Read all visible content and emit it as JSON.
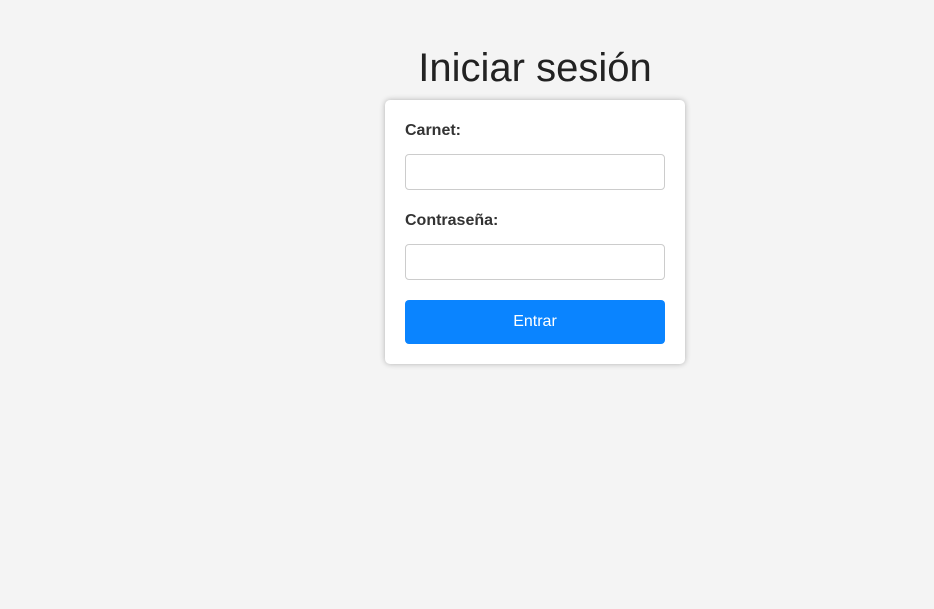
{
  "page": {
    "title": "Iniciar sesión"
  },
  "form": {
    "carnet_label": "Carnet:",
    "carnet_value": "",
    "password_label": "Contraseña:",
    "password_value": "",
    "submit_label": "Entrar"
  },
  "colors": {
    "background": "#f4f4f4",
    "card": "#ffffff",
    "accent": "#0a84ff",
    "button_text": "#ffffff"
  }
}
